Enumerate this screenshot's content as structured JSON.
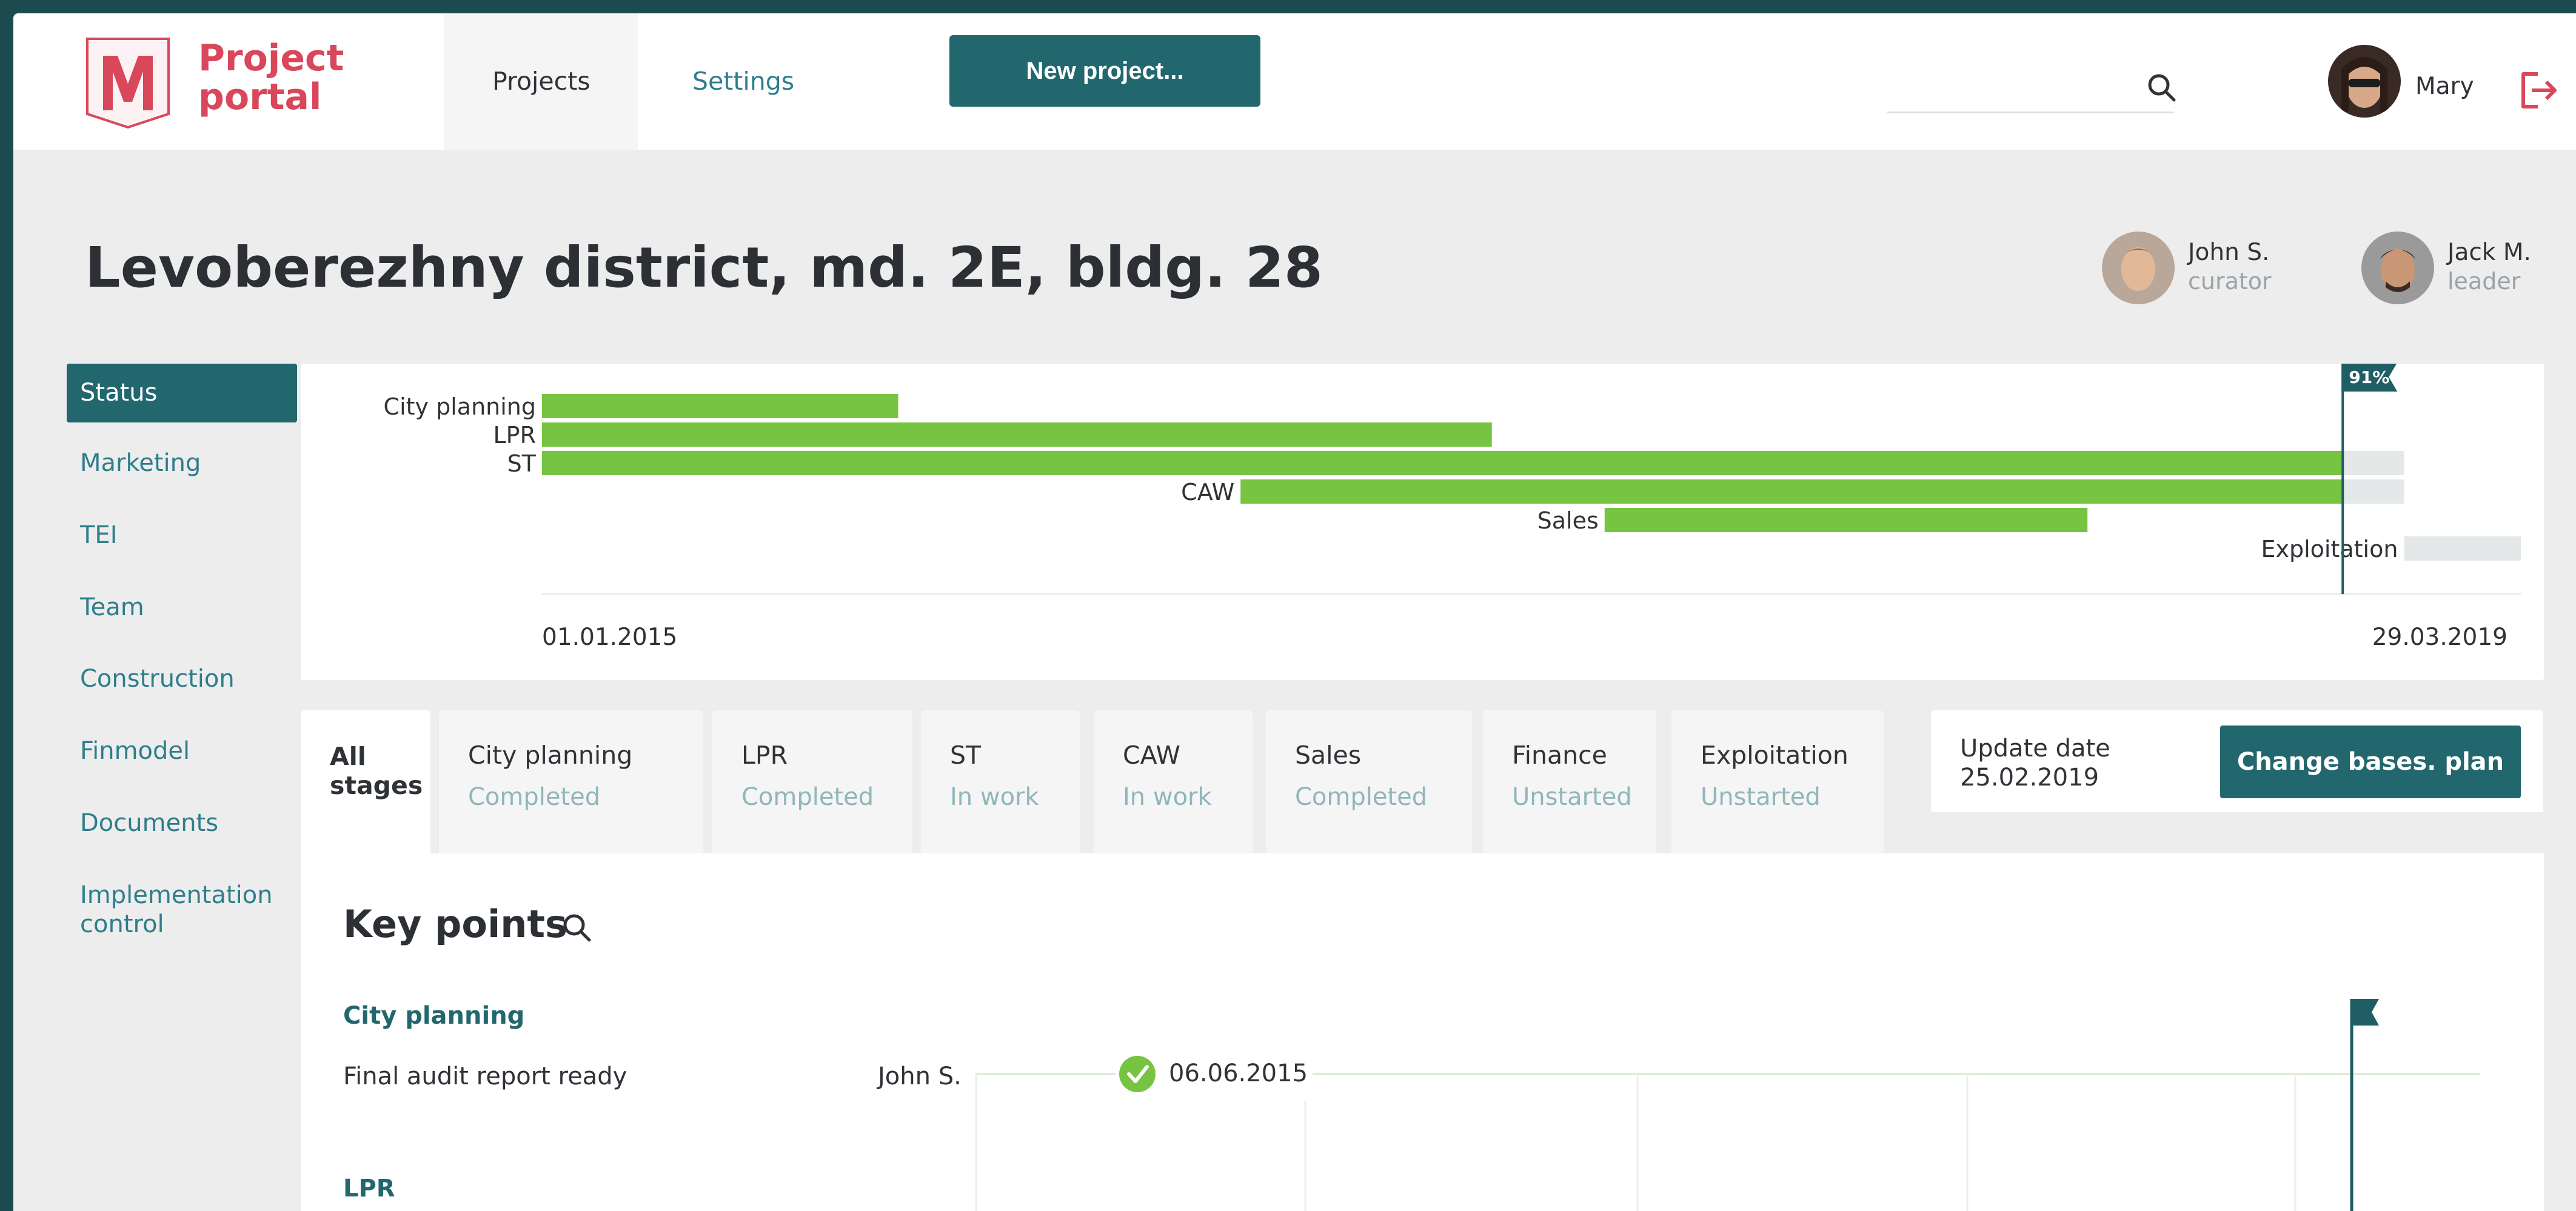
{
  "header": {
    "brand_line1": "Project",
    "brand_line2": "portal",
    "nav": {
      "projects": "Projects",
      "settings": "Settings"
    },
    "new_project_label": "New project...",
    "search": {
      "placeholder": ""
    },
    "user_name": "Mary"
  },
  "project": {
    "title": "Levoberezhny district, md. 2E, bldg. 28",
    "people": [
      {
        "name": "John S.",
        "role": "curator"
      },
      {
        "name": "Jack M.",
        "role": "leader"
      }
    ]
  },
  "sidebar": {
    "items": [
      {
        "label": "Status"
      },
      {
        "label": "Marketing"
      },
      {
        "label": "TEI"
      },
      {
        "label": "Team"
      },
      {
        "label": "Construction"
      },
      {
        "label": "Finmodel"
      },
      {
        "label": "Documents"
      },
      {
        "label": "Implementation control"
      }
    ]
  },
  "gantt": {
    "start_label": "01.01.2015",
    "end_label": "29.03.2019",
    "progress_label": "91%"
  },
  "chart_data": {
    "type": "gantt",
    "x_range": [
      "01.01.2015",
      "29.03.2019"
    ],
    "today_fraction": 0.91,
    "tasks": [
      {
        "name": "City planning",
        "done_start": 0.0,
        "done_end": 0.18,
        "planned_end": 0.18
      },
      {
        "name": "LPR",
        "done_start": 0.0,
        "done_end": 0.48,
        "planned_end": 0.48
      },
      {
        "name": "ST",
        "done_start": 0.0,
        "done_end": 0.91,
        "planned_end": 0.941
      },
      {
        "name": "CAW",
        "done_start": 0.353,
        "done_end": 0.91,
        "planned_end": 0.941
      },
      {
        "name": "Sales",
        "done_start": 0.537,
        "done_end": 0.781,
        "planned_end": 0.781
      },
      {
        "name": "Exploitation",
        "done_start": 0.941,
        "done_end": 0.941,
        "planned_end": 1.0
      }
    ],
    "colors": {
      "done": "#76c442",
      "planned": "#e4e8e9",
      "marker": "#1f5e64"
    }
  },
  "stages": [
    {
      "name": "All stages",
      "status": ""
    },
    {
      "name": "City planning",
      "status": "Completed"
    },
    {
      "name": "LPR",
      "status": "Completed"
    },
    {
      "name": "ST",
      "status": "In work"
    },
    {
      "name": "CAW",
      "status": "In work"
    },
    {
      "name": "Sales",
      "status": "Completed"
    },
    {
      "name": "Finance",
      "status": "Unstarted"
    },
    {
      "name": "Exploitation",
      "status": "Unstarted"
    }
  ],
  "update": {
    "label": "Update date",
    "date": "25.02.2019"
  },
  "change_plan_label": "Change bases. plan",
  "key_points": {
    "title": "Key points",
    "sections": [
      {
        "name": "City planning",
        "items": [
          {
            "task": "Final audit report ready",
            "owner": "John S.",
            "date": "06.06.2015"
          }
        ]
      },
      {
        "name": "LPR",
        "items": []
      }
    ]
  },
  "colors": {
    "accent": "#22676e",
    "brand": "#d9475b",
    "success": "#76c442"
  }
}
